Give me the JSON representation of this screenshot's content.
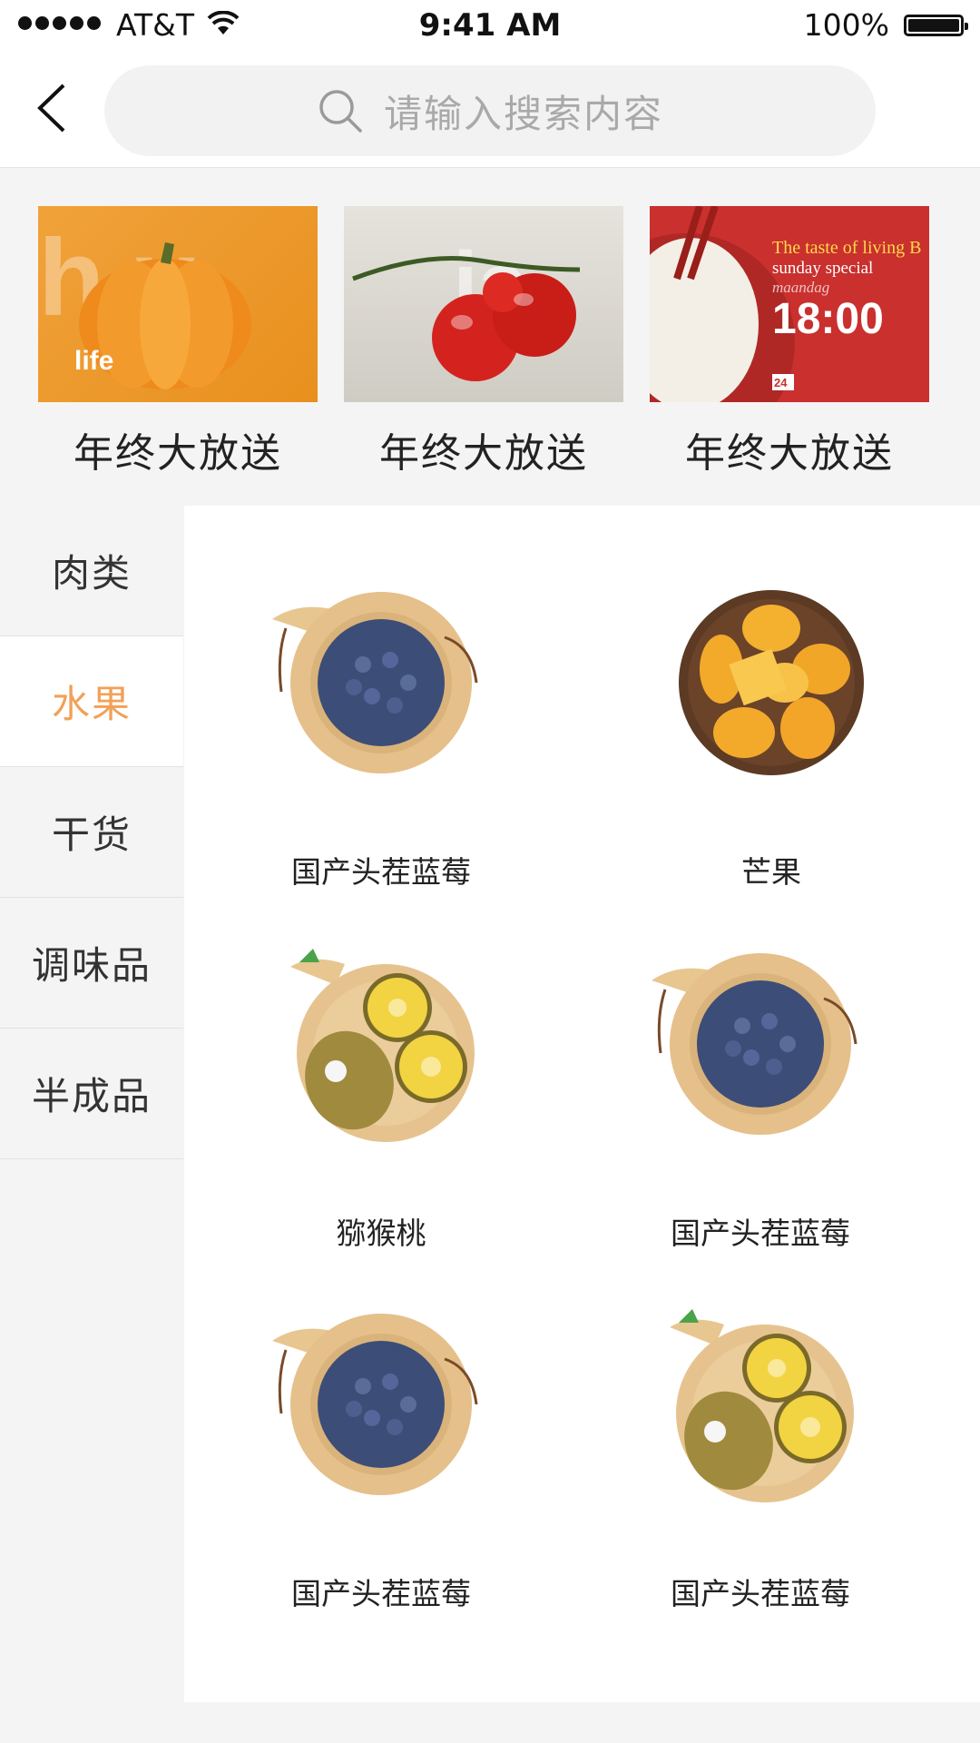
{
  "status_bar": {
    "carrier": "AT&T",
    "time": "9:41 AM",
    "battery": "100%"
  },
  "nav": {
    "search_placeholder": "请输入搜索内容"
  },
  "banner": {
    "promos": [
      {
        "title": "年终大放送",
        "image_text": "life"
      },
      {
        "title": "年终大放送"
      },
      {
        "title": "年终大放送",
        "image_text_1": "The taste of living B",
        "image_text_2": "sunday special",
        "image_text_3": "maandag",
        "image_time": "18:00",
        "image_logo": "24"
      }
    ]
  },
  "categories": [
    {
      "label": "肉类",
      "active": false
    },
    {
      "label": "水果",
      "active": true
    },
    {
      "label": "干货",
      "active": false
    },
    {
      "label": "调味品",
      "active": false
    },
    {
      "label": "半成品",
      "active": false
    }
  ],
  "products": [
    {
      "name": "国产头茬蓝莓",
      "image": "blueberry-bowl"
    },
    {
      "name": "芒果",
      "image": "mango-bowl"
    },
    {
      "name": "猕猴桃",
      "image": "kiwi-bowl"
    },
    {
      "name": "国产头茬蓝莓",
      "image": "blueberry-bowl"
    },
    {
      "name": "国产头茬蓝莓",
      "image": "blueberry-bowl"
    },
    {
      "name": "国产头茬蓝莓",
      "image": "kiwi-bowl"
    }
  ],
  "colors": {
    "accent": "#f2a057",
    "background": "#f4f4f4"
  }
}
